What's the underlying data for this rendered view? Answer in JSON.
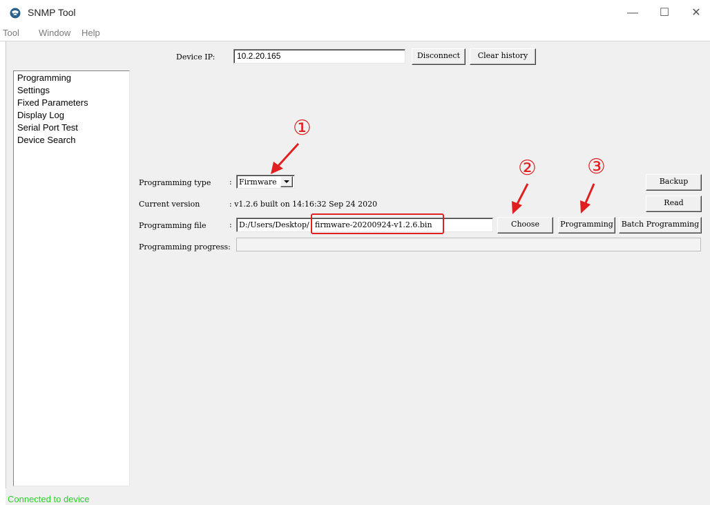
{
  "window": {
    "title": "SNMP Tool",
    "minimize_glyph": "—",
    "maximize_glyph": "☐",
    "close_glyph": "✕"
  },
  "menubar": {
    "items": [
      "Tool",
      "Window",
      "Help"
    ]
  },
  "top": {
    "device_ip_label": "Device IP:",
    "device_ip_value": "10.2.20.165",
    "disconnect_label": "Disconnect",
    "clear_history_label": "Clear history"
  },
  "nav": {
    "items": [
      "Programming",
      "Settings",
      "Fixed Parameters",
      "Display Log",
      "Serial Port Test",
      "Device Search"
    ]
  },
  "form": {
    "programming_type_label": "Programming type",
    "colon": ":",
    "programming_type_value": "Firmware",
    "current_version_label": "Current version",
    "current_version_value": ": v1.2.6 built on 14:16:32 Sep 24 2020",
    "programming_file_label": "Programming file",
    "programming_file_prefix": "D:/Users/Desktop/",
    "programming_file_highlight": "firmware-20200924-v1.2.6.bin",
    "programming_progress_label": "Programming progress:",
    "programming_progress_value": 0
  },
  "buttons": {
    "backup": "Backup",
    "read": "Read",
    "choose": "Choose",
    "programming": "Programming",
    "batch_programming": "Batch Programming"
  },
  "annotations": {
    "step1": "①",
    "step2": "②",
    "step3": "③",
    "color": "#e02020"
  },
  "status": {
    "text": "Connected to device",
    "color": "#2bd12b"
  }
}
